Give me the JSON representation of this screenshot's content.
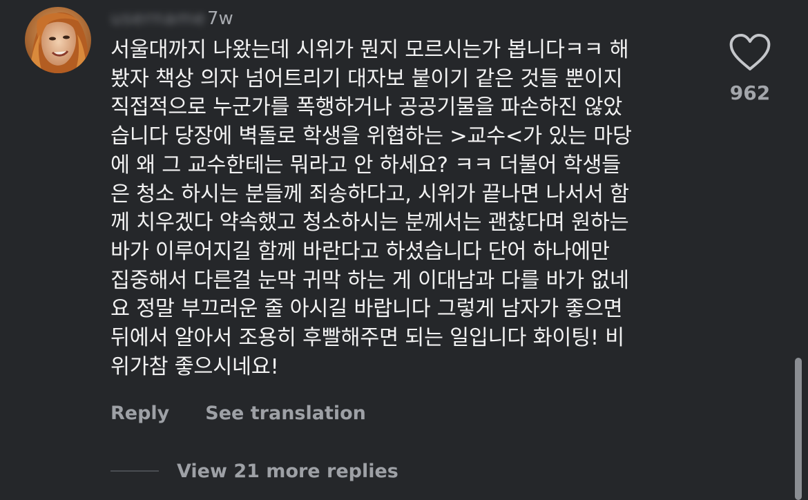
{
  "comment": {
    "username": "username",
    "timestamp": "7w",
    "text": "서울대까지 나왔는데 시위가 뭔지 모르시는가 봅니다ㅋㅋ 해\n봤자 책상 의자 넘어트리기 대자보 붙이기 같은 것들 뿐이지\n직접적으로 누군가를 폭행하거나 공공기물을 파손하진 않았\n습니다 당장에 벽돌로 학생을 위협하는 >교수<가 있는 마당\n에 왜 그 교수한테는 뭐라고 안 하세요? ㅋㅋ 더불어 학생들\n은 청소 하시는 분들께 죄송하다고, 시위가 끝나면 나서서 함\n께 치우겠다 약속했고 청소하시는 분께서는 괜찮다며 원하는\n바가 이루어지길 함께 바란다고 하셨습니다 단어 하나에만\n집중해서 다른걸 눈막 귀막 하는 게 이대남과 다를 바가 없네\n요 정말 부끄러운 줄 아시길 바랍니다 그렇게 남자가 좋으면\n뒤에서 알아서 조용히 후빨해주면 되는 일입니다 화이팅! 비\n위가참 좋으시네요!",
    "like_count": "962",
    "like_icon": "heart-outline-icon"
  },
  "actions": {
    "reply_label": "Reply",
    "translate_label": "See translation"
  },
  "replies": {
    "view_more_label": "View 21 more replies"
  },
  "colors": {
    "background": "#25272a",
    "text_primary": "#f2f2f2",
    "text_secondary": "#9ea1a6"
  }
}
